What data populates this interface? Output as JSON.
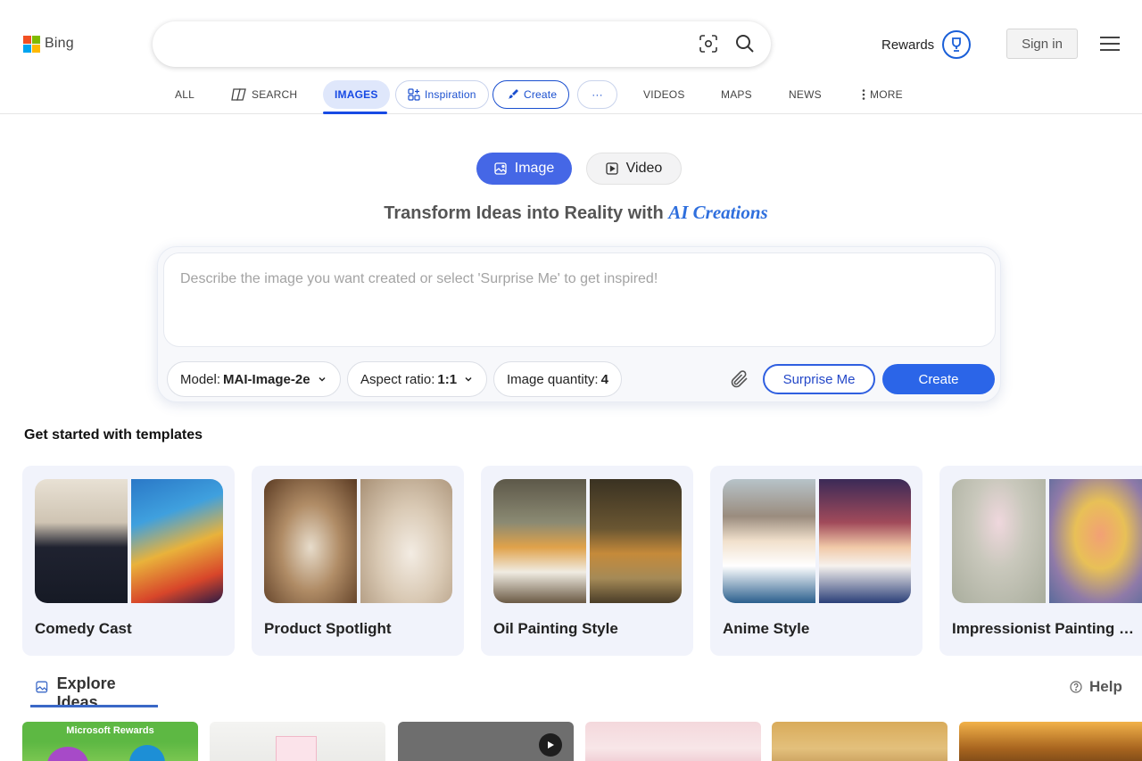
{
  "brand": {
    "name": "Bing",
    "logo_colors": [
      "#f25022",
      "#7fba00",
      "#00a4ef",
      "#ffb900"
    ]
  },
  "search": {
    "value": "",
    "placeholder": ""
  },
  "header": {
    "rewards_label": "Rewards",
    "signin_label": "Sign in"
  },
  "scope_tabs": {
    "all": "ALL",
    "search": "SEARCH",
    "images": "IMAGES",
    "inspiration": "Inspiration",
    "create": "Create",
    "more_dots": "···",
    "videos": "VIDEOS",
    "maps": "MAPS",
    "news": "NEWS",
    "more": "MORE"
  },
  "mode": {
    "image_label": "Image",
    "video_label": "Video"
  },
  "headline": {
    "prefix": "Transform Ideas into Reality with ",
    "highlight": "AI Creations"
  },
  "prompt": {
    "placeholder": "Describe the image you want created or select 'Surprise Me' to get inspired!",
    "model_label": "Model:",
    "model_value": "MAI-Image-2e",
    "aspect_label": "Aspect ratio:",
    "aspect_value": "1:1",
    "quantity_label": "Image quantity:",
    "quantity_value": "4",
    "surprise_label": "Surprise Me",
    "create_label": "Create"
  },
  "templates": {
    "title": "Get started with templates",
    "items": [
      {
        "label": "Comedy Cast"
      },
      {
        "label": "Product Spotlight"
      },
      {
        "label": "Oil Painting Style"
      },
      {
        "label": "Anime Style"
      },
      {
        "label": "Impressionist Painting …"
      }
    ]
  },
  "explore": {
    "title": "Explore Ideas",
    "help_label": "Help",
    "first_card_label": "Microsoft Rewards"
  },
  "colors": {
    "accent": "#2b65e8",
    "images_tab_bg": "#dfe7fb",
    "template_card_bg": "#f1f3fb"
  }
}
